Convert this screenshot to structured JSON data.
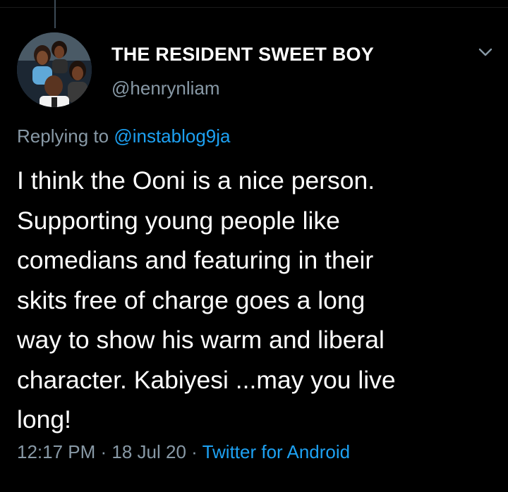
{
  "author": {
    "display_name": "THE RESIDENT SWEET BOY",
    "handle": "@henrynliam"
  },
  "reply": {
    "prefix": "Replying to ",
    "mention": "@instablog9ja"
  },
  "tweet": {
    "lines": [
      "I think the Ooni is a nice person.",
      "Supporting young people like",
      "comedians and featuring in their",
      "skits free of charge goes a long",
      "way to show his warm and liberal",
      "character. Kabiyesi ...may you live",
      "long!"
    ]
  },
  "meta": {
    "time": "12:17 PM",
    "sep1": " · ",
    "date": "18 Jul 20",
    "sep2": " · ",
    "source": "Twitter for Android"
  },
  "icons": {
    "menu": "chevron-down-icon",
    "avatar": "profile-photo"
  },
  "colors": {
    "background": "#000000",
    "text": "#ffffff",
    "muted": "#8899a6",
    "link": "#1da1f2"
  }
}
